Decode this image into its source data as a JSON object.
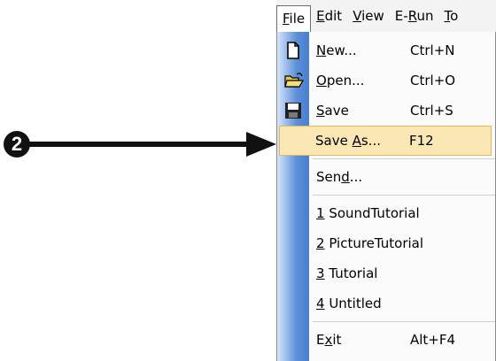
{
  "callout": {
    "number": "2"
  },
  "menubar": {
    "items": [
      {
        "label": "File",
        "underline": "F"
      },
      {
        "label": "Edit",
        "underline": "E"
      },
      {
        "label": "View",
        "underline": "V"
      },
      {
        "label": "E-Run",
        "underline": "R"
      },
      {
        "label": "To",
        "underline": "T"
      }
    ]
  },
  "file_menu": {
    "new": {
      "label_pre": "",
      "label_key": "N",
      "label_post": "ew...",
      "shortcut": "Ctrl+N",
      "icon": "new-document-icon"
    },
    "open": {
      "label_pre": "",
      "label_key": "O",
      "label_post": "pen...",
      "shortcut": "Ctrl+O",
      "icon": "open-folder-icon"
    },
    "save": {
      "label_pre": "",
      "label_key": "S",
      "label_post": "ave",
      "shortcut": "Ctrl+S",
      "icon": "floppy-disk-icon"
    },
    "save_as": {
      "label_pre": "Save ",
      "label_key": "A",
      "label_post": "s...",
      "shortcut": "F12"
    },
    "send": {
      "label_pre": "Sen",
      "label_key": "d",
      "label_post": "..."
    },
    "recent": [
      {
        "key": "1",
        "name": " SoundTutorial"
      },
      {
        "key": "2",
        "name": " PictureTutorial"
      },
      {
        "key": "3",
        "name": " Tutorial"
      },
      {
        "key": "4",
        "name": " Untitled"
      }
    ],
    "exit": {
      "label_pre": "E",
      "label_key": "x",
      "label_post": "it",
      "shortcut": "Alt+F4"
    }
  },
  "colors": {
    "highlight": "#fbe7b3",
    "gutter": "#5d8fd8"
  }
}
